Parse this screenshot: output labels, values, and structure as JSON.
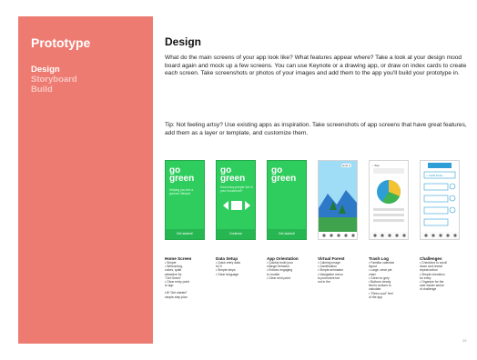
{
  "sidebar": {
    "title": "Prototype",
    "items": [
      {
        "label": "Design",
        "active": true
      },
      {
        "label": "Storyboard",
        "active": false
      },
      {
        "label": "Build",
        "active": false
      }
    ]
  },
  "main": {
    "title": "Design",
    "paragraph": "What do the main screens of your app look like? What features appear where? Take a look at your design mood board again and mock up a few screens. You can use Keynote or a drawing app, or draw on index cards to create each screen. Take screenshots or photos of your images and add them to the app you'll build your prototype in.",
    "tip": "Tip: Not feeling artsy? Use existing apps as inspiration. Take screenshots of app screens that have great features, add them as a layer or template, and customize them."
  },
  "screenshots": {
    "logo_line1": "go",
    "logo_line2": "green",
    "home_tagline": "Helping you live a greener lifestyle",
    "home_button": "Get started!",
    "setup_tagline": "How many people live in your household?",
    "setup_button": "Continue",
    "orientation_button": "Get started!",
    "forest_badge": "level 3",
    "trash_badge": "↓ Sep",
    "challenge_item": "✓ Refill bottle"
  },
  "columns": [
    {
      "title": "Home Screen",
      "lines": [
        "• Simple",
        "• Welcoming,",
        "  colors, quite",
        "  attractive for",
        "  \"Get Green\"",
        "• Clear entry point",
        "  to app",
        "",
        "Lift \"Get started\"",
        "simple-step plan"
      ]
    },
    {
      "title": "Data Setup",
      "lines": [
        "• Quick entry data",
        "  for it",
        "• Simple steps",
        "• Clear language"
      ]
    },
    {
      "title": "App Orientation",
      "lines": [
        "• Quickly build your",
        "  change behavior",
        "• Entices engaging",
        "  to trouble",
        "• Clear next point"
      ]
    },
    {
      "title": "Virtual Forest",
      "lines": [
        "• Calming image",
        "• Gamification",
        "• Simple animation",
        "• Navigation menu",
        "  is prominent but",
        "  not in the"
      ]
    },
    {
      "title": "Trash Log",
      "lines": [
        "• Familiar calendar",
        "  layout",
        "• Large, clear pie",
        "  chart",
        "• Green to grey",
        "• Buttons clearly",
        "  tied to actions to",
        "  calculate",
        "• \"Retro-cool\" feel",
        "  of the app"
      ]
    },
    {
      "title": "Challenges",
      "lines": [
        "• Checkbox to scroll",
        "  down and reveal",
        "  repeat action",
        "• Simple checkbox",
        "  for entry",
        "• Organize for the",
        "  user easier sense",
        "  of challenge"
      ]
    }
  ],
  "page_number": "25",
  "colors": {
    "sidebar": "#ee7b72",
    "green": "#2fcc5e"
  }
}
